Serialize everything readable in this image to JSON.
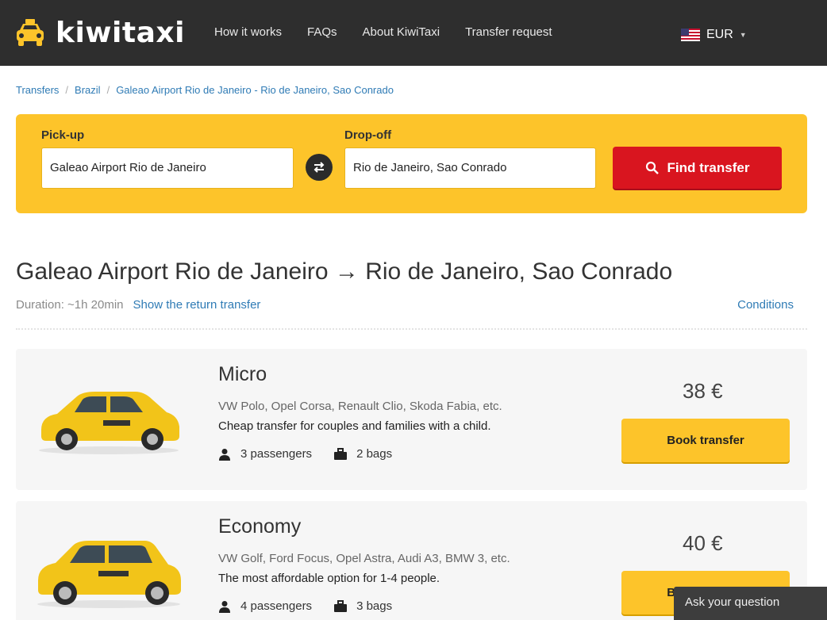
{
  "header": {
    "logo_text": "kiwitaxi",
    "nav": [
      "How it works",
      "FAQs",
      "About KiwiTaxi",
      "Transfer request"
    ],
    "currency": "EUR"
  },
  "breadcrumb": [
    "Transfers",
    "Brazil",
    "Galeao Airport Rio de Janeiro - Rio de Janeiro, Sao Conrado"
  ],
  "search": {
    "pickup_label": "Pick-up",
    "pickup_value": "Galeao Airport Rio de Janeiro",
    "dropoff_label": "Drop-off",
    "dropoff_value": "Rio de Janeiro, Sao Conrado",
    "find_label": "Find transfer"
  },
  "route": {
    "title": "Galeao Airport Rio de Janeiro → Rio de Janeiro, Sao Conrado",
    "duration": "Duration: ~1h 20min",
    "return_link": "Show the return transfer",
    "conditions": "Conditions"
  },
  "cards": [
    {
      "name": "Micro",
      "models": "VW Polo, Opel Corsa, Renault Clio, Skoda Fabia, etc.",
      "desc": "Cheap transfer for couples and families with a child.",
      "passengers": "3 passengers",
      "bags": "2 bags",
      "price": "38  €",
      "book_label": "Book transfer"
    },
    {
      "name": "Economy",
      "models": "VW Golf, Ford Focus, Opel Astra, Audi A3, BMW 3, etc.",
      "desc": "The most affordable option for 1-4 people.",
      "passengers": "4 passengers",
      "bags": "3 bags",
      "price": "40  €",
      "book_label": "Book transfer"
    }
  ],
  "chat": {
    "label": "Ask your question"
  },
  "colors": {
    "header_bg": "#2e2e2e",
    "accent_yellow": "#fdc42a",
    "find_red": "#d9151f",
    "link_blue": "#2f7bb5"
  }
}
